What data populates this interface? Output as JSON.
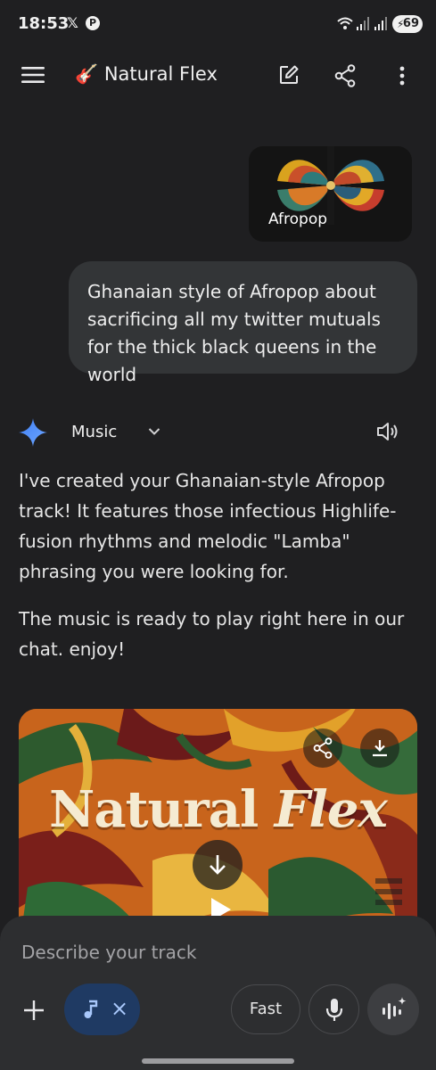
{
  "status_bar": {
    "time": "18:53",
    "notif_x": "𝕏",
    "notif_p": "P",
    "battery": "69"
  },
  "app_bar": {
    "title_emoji": "🎸",
    "title": "Natural Flex",
    "icons": [
      "menu-icon",
      "edit-icon",
      "share-icon",
      "more-vert-icon"
    ]
  },
  "user_prompt": {
    "attachment_label": "Afropop",
    "text": "Ghanaian style of Afropop about sacrificing all my twitter mutuals for the thick black queens in the world"
  },
  "response": {
    "model_label": "Music",
    "paragraph_1": "I've created your Ghanaian-style Afropop track! It features those infectious Highlife-fusion rhythms and melodic \"Lamba\" phrasing you were looking for.",
    "paragraph_2": "The music is ready to play right here in our chat. enjoy!"
  },
  "track_card": {
    "title_part1": "Natural",
    "title_part2": "Flex"
  },
  "composer": {
    "placeholder": "Describe your track",
    "chip_close": "×",
    "fast_label": "Fast"
  },
  "colors": {
    "background": "#1f1f21",
    "bubble": "#333537",
    "composer": "#2d2e30",
    "chip": "#1f3a63",
    "gemini_blue": "#4a8cf5"
  }
}
